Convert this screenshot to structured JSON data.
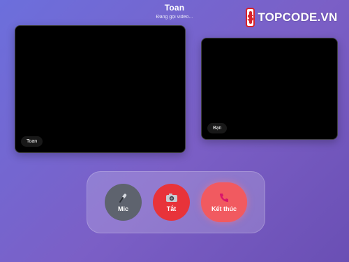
{
  "call": {
    "caller_name": "Toan",
    "status": "Đang gọi video..."
  },
  "logo": {
    "mark": "S",
    "text": "TOPCODE.VN"
  },
  "videos": {
    "remote_label": "Toan",
    "self_label": "Bạn"
  },
  "controls": {
    "mic": {
      "label": "Mic",
      "icon": "microphone-icon"
    },
    "camera": {
      "label": "Tắt",
      "icon": "camera-icon"
    },
    "end": {
      "label": "Kết thúc",
      "icon": "phone-icon"
    }
  },
  "colors": {
    "background_start": "#6c6fdc",
    "background_end": "#6a4fb4",
    "mic_button": "#5e636e",
    "camera_button": "#e8333a",
    "end_button": "#f15a60",
    "logo_red": "#d8232a"
  }
}
